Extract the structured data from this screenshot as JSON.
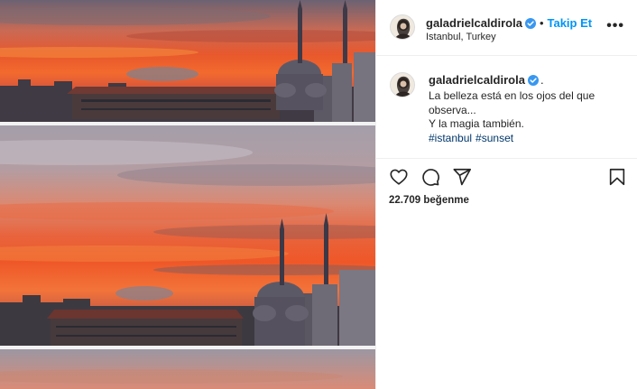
{
  "post": {
    "username": "galadrielcaldirola",
    "follow_label": "Takip Et",
    "location": "Istanbul, Turkey",
    "more_label": "•••",
    "separator": "•"
  },
  "caption": {
    "username": "galadrielcaldirola",
    "trailing": ".",
    "line1": "La belleza está en los ojos del que observa...",
    "line2": "Y la magia también.",
    "hashtags": [
      "#istanbul",
      "#sunset"
    ]
  },
  "actions": {
    "icons": [
      "heart-icon",
      "comment-icon",
      "share-icon",
      "bookmark-icon"
    ]
  },
  "likes_text": "22.709 beğenme",
  "colors": {
    "accent": "#0095f6",
    "hashtag": "#00376b",
    "text": "#262626",
    "border": "#efefef",
    "sunset_orange": "#f0552a",
    "sky_gray": "#9a93a4"
  }
}
